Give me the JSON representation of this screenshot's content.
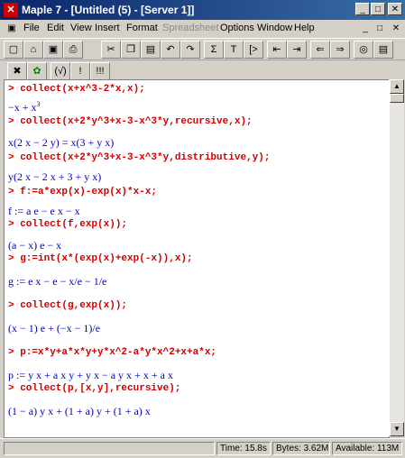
{
  "window": {
    "title": "Maple 7 - [Untitled (5) - [Server 1]]",
    "icon": "maple-leaf-icon",
    "controls": [
      "_",
      "□",
      "✕"
    ]
  },
  "menu": {
    "items": [
      {
        "label": "File",
        "enabled": true
      },
      {
        "label": "Edit",
        "enabled": true
      },
      {
        "label": "View",
        "enabled": true
      },
      {
        "label": "Insert",
        "enabled": true
      },
      {
        "label": "Format",
        "enabled": true
      },
      {
        "label": "Spreadsheet",
        "enabled": false
      },
      {
        "label": "Options",
        "enabled": true
      },
      {
        "label": "Window",
        "enabled": true
      },
      {
        "label": "Help",
        "enabled": true
      }
    ],
    "doc_controls": [
      "_",
      "□",
      "✕"
    ]
  },
  "toolbar": {
    "buttons": [
      "new-icon",
      "open-icon",
      "save-icon",
      "print-icon",
      "cut-icon",
      "copy-icon",
      "paste-icon",
      "undo-icon",
      "redo-icon"
    ],
    "symbols": {
      "sigma": "Σ",
      "text": "T",
      "prompt": "[>"
    }
  },
  "toolbar2": {
    "buttons": [
      "x-icon",
      "leaf-icon",
      "(√)",
      "!",
      "!!!"
    ]
  },
  "worksheet": {
    "lines": [
      {
        "type": "cmd",
        "text": "> collect(x+x^3-2*x,x);"
      },
      {
        "type": "out",
        "text": "−x + x",
        "sup": "3"
      },
      {
        "type": "cmd",
        "text": "> collect(x+2*y^3+x-3-x^3*y,recursive,x);"
      },
      {
        "type": "out",
        "text": "x(2 x − 2 y) = x(3 + y x)"
      },
      {
        "type": "cmd",
        "text": "> collect(x+2*y^3+x-3-x^3*y,distributive,y);"
      },
      {
        "type": "out",
        "text": "y(2 x − 2 x + 3 + y x)"
      },
      {
        "type": "cmd",
        "text": "> f:=a*exp(x)-exp(x)*x-x;"
      },
      {
        "type": "out",
        "text": "f := a e − e x − x"
      },
      {
        "type": "cmd",
        "text": "> collect(f,exp(x));"
      },
      {
        "type": "out",
        "text": "(a − x) e − x"
      },
      {
        "type": "cmd",
        "text": "> g:=int(x*(exp(x)+exp(-x)),x);"
      },
      {
        "type": "out",
        "text": "g := e x − e − x/e − 1/e"
      },
      {
        "type": "cmd",
        "text": "> collect(g,exp(x));"
      },
      {
        "type": "out",
        "text": "(x − 1) e + (−x − 1)/e"
      },
      {
        "type": "cmd",
        "text": "> p:=x*y+a*x*y+y*x^2-a*y*x^2+x+a*x;"
      },
      {
        "type": "out",
        "text": "p := y x + a x y + y x − a y x + x + a x"
      },
      {
        "type": "cmd",
        "text": "> collect(p,[x,y],recursive);"
      },
      {
        "type": "out",
        "text": "(1 − a) y x + (1 + a) y + (1 + a) x"
      }
    ]
  },
  "status": {
    "time": "Time: 15.8s",
    "bytes": "Bytes: 3.62M",
    "available": "Available: 113M"
  }
}
